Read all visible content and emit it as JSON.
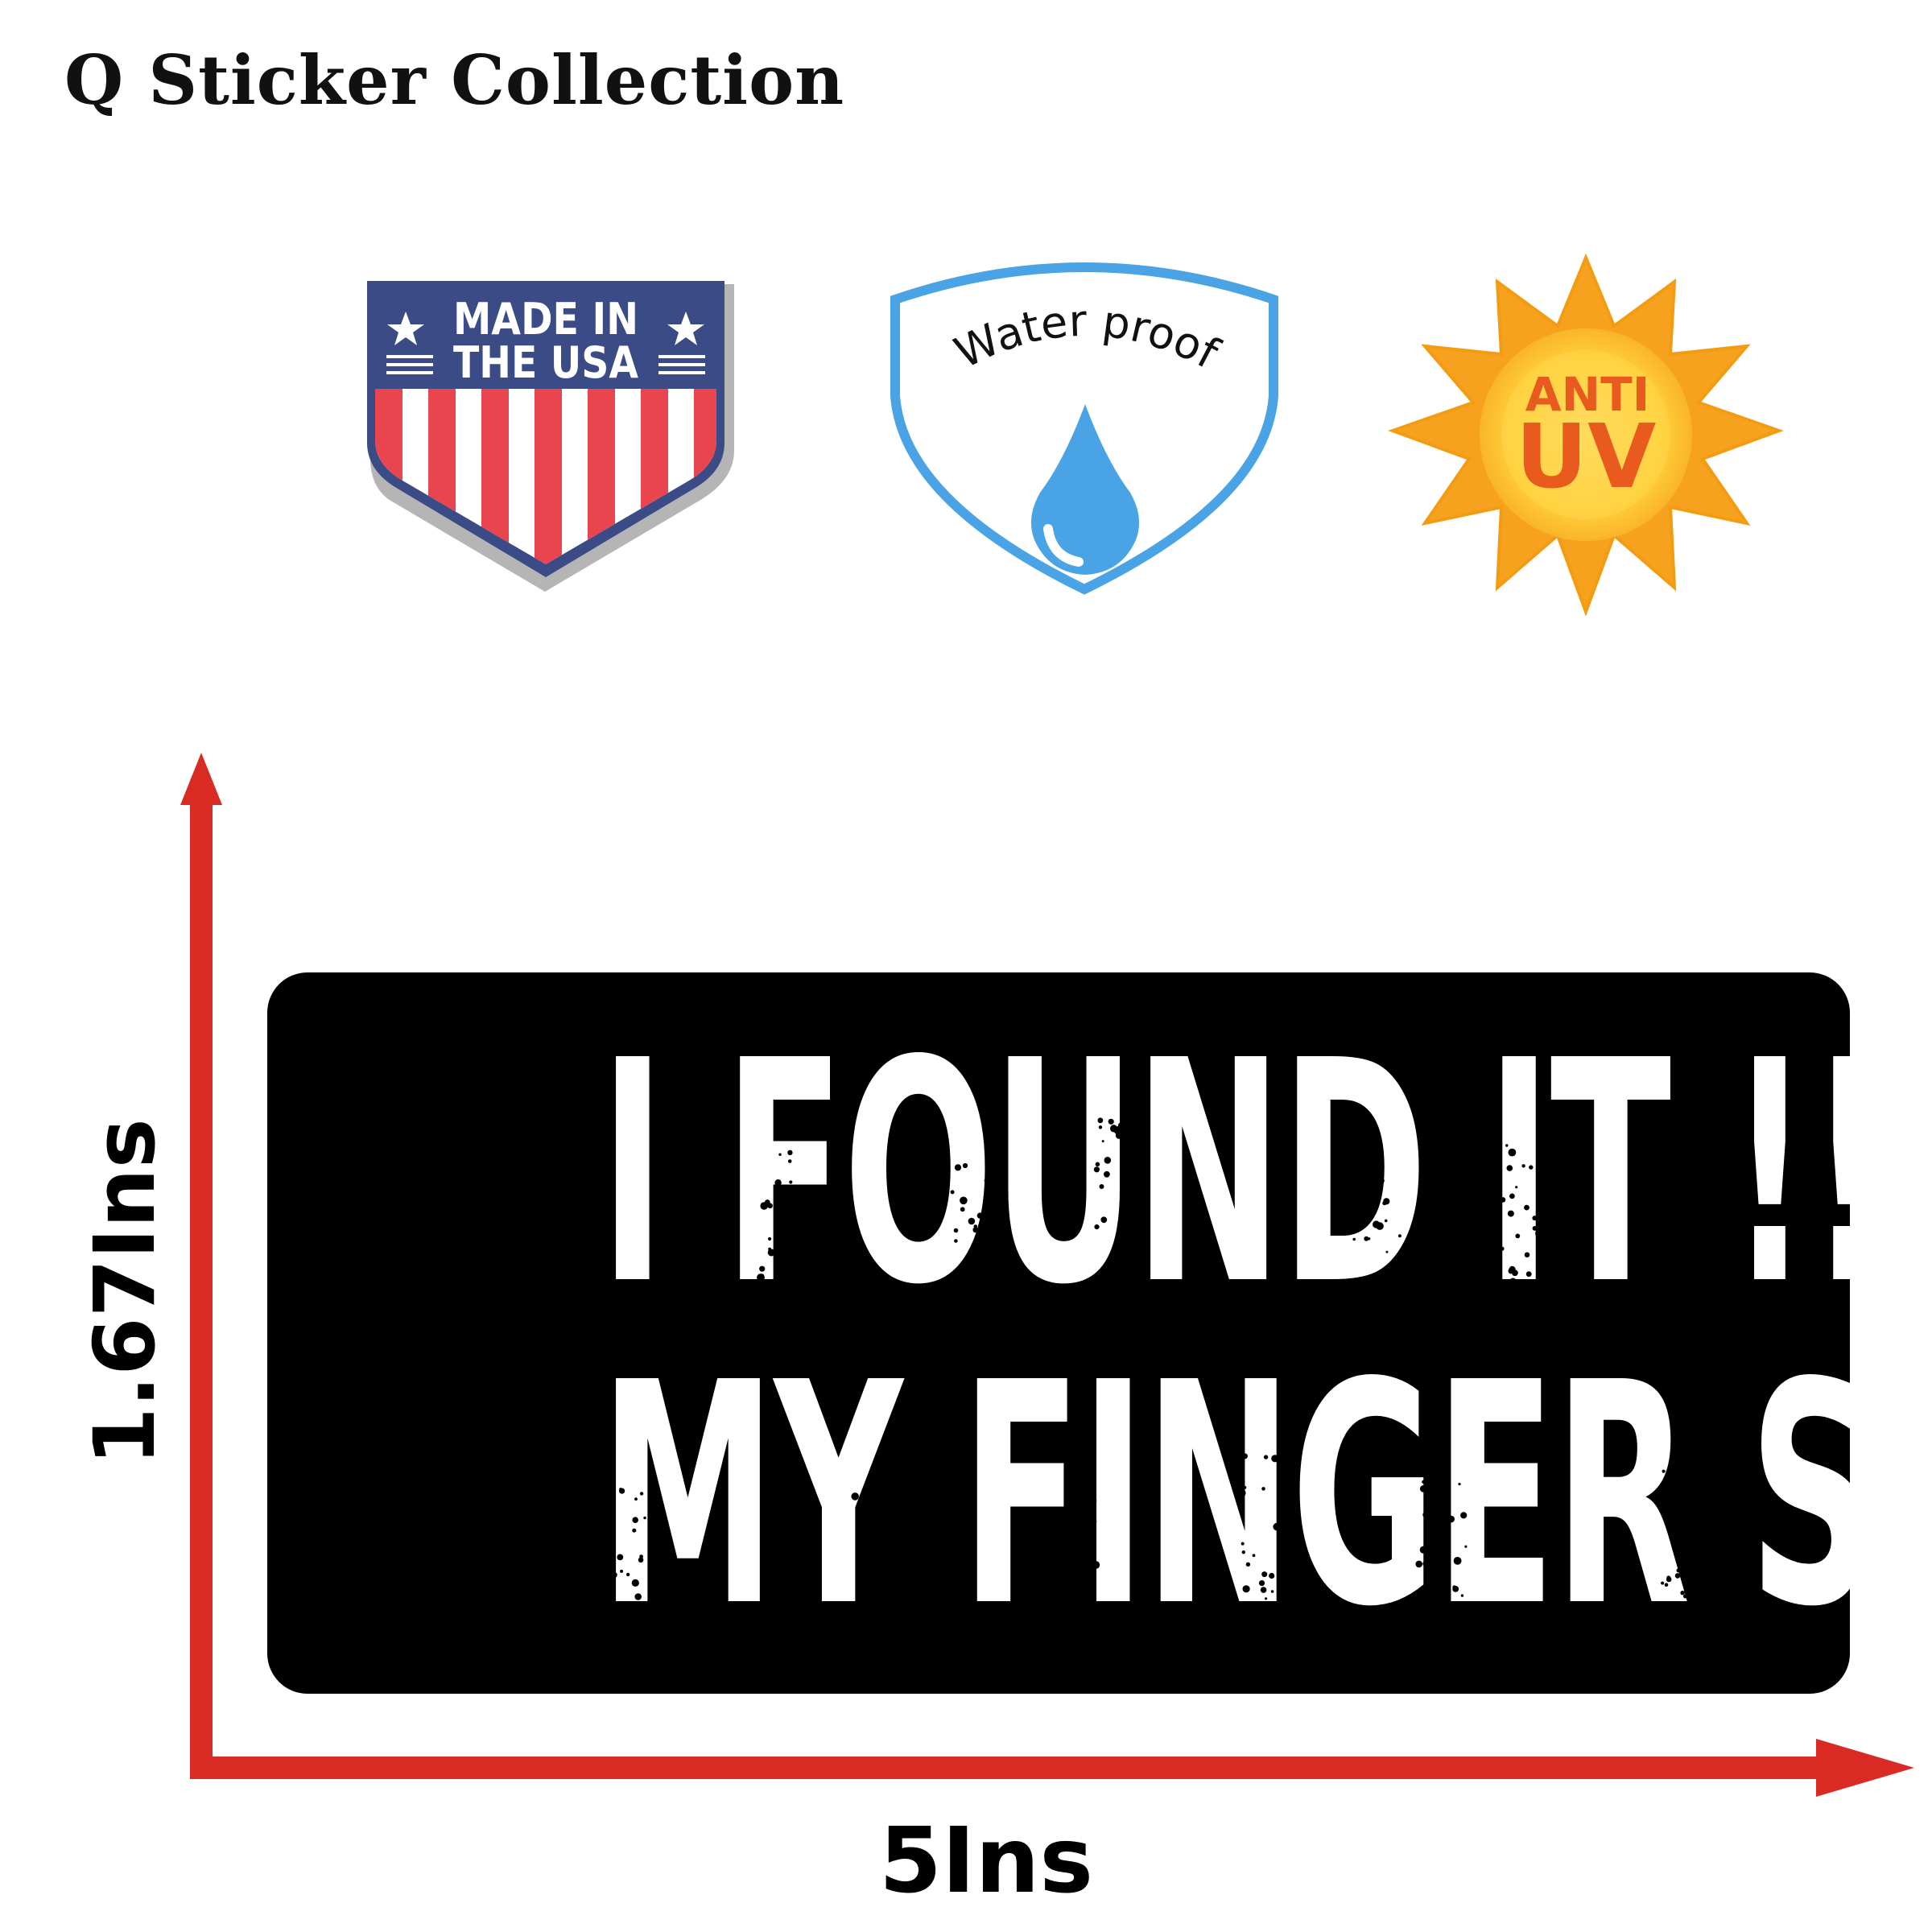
{
  "brand": {
    "title": "Q Sticker Collection"
  },
  "badges": {
    "usa": {
      "line1": "MADE IN",
      "line2": "THE USA",
      "colors": {
        "navy": "#3b4b86",
        "red": "#e8454e",
        "white": "#ffffff",
        "shadow": "#b5b5b5"
      },
      "icon": "made-in-usa-shield-icon"
    },
    "waterproof": {
      "label": "Water proof",
      "colors": {
        "border": "#4aa3e4",
        "drop": "#4aa3e4",
        "text": "#111111"
      },
      "icon": "water-drop-icon"
    },
    "anti_uv": {
      "line1": "ANTI",
      "line2": "UV",
      "colors": {
        "sun": "#f6a21e",
        "center": "#ffd54a",
        "text": "#e85a1e"
      },
      "icon": "sun-icon"
    }
  },
  "dimensions": {
    "height_label": "1.67Ins",
    "width_label": "5Ins",
    "arrow_color": "#d92b23"
  },
  "sticker": {
    "line1": "I FOUND IT !! NOW",
    "line2": "MY FINGER STINKS",
    "background": "#000000",
    "text_color": "#ffffff"
  }
}
